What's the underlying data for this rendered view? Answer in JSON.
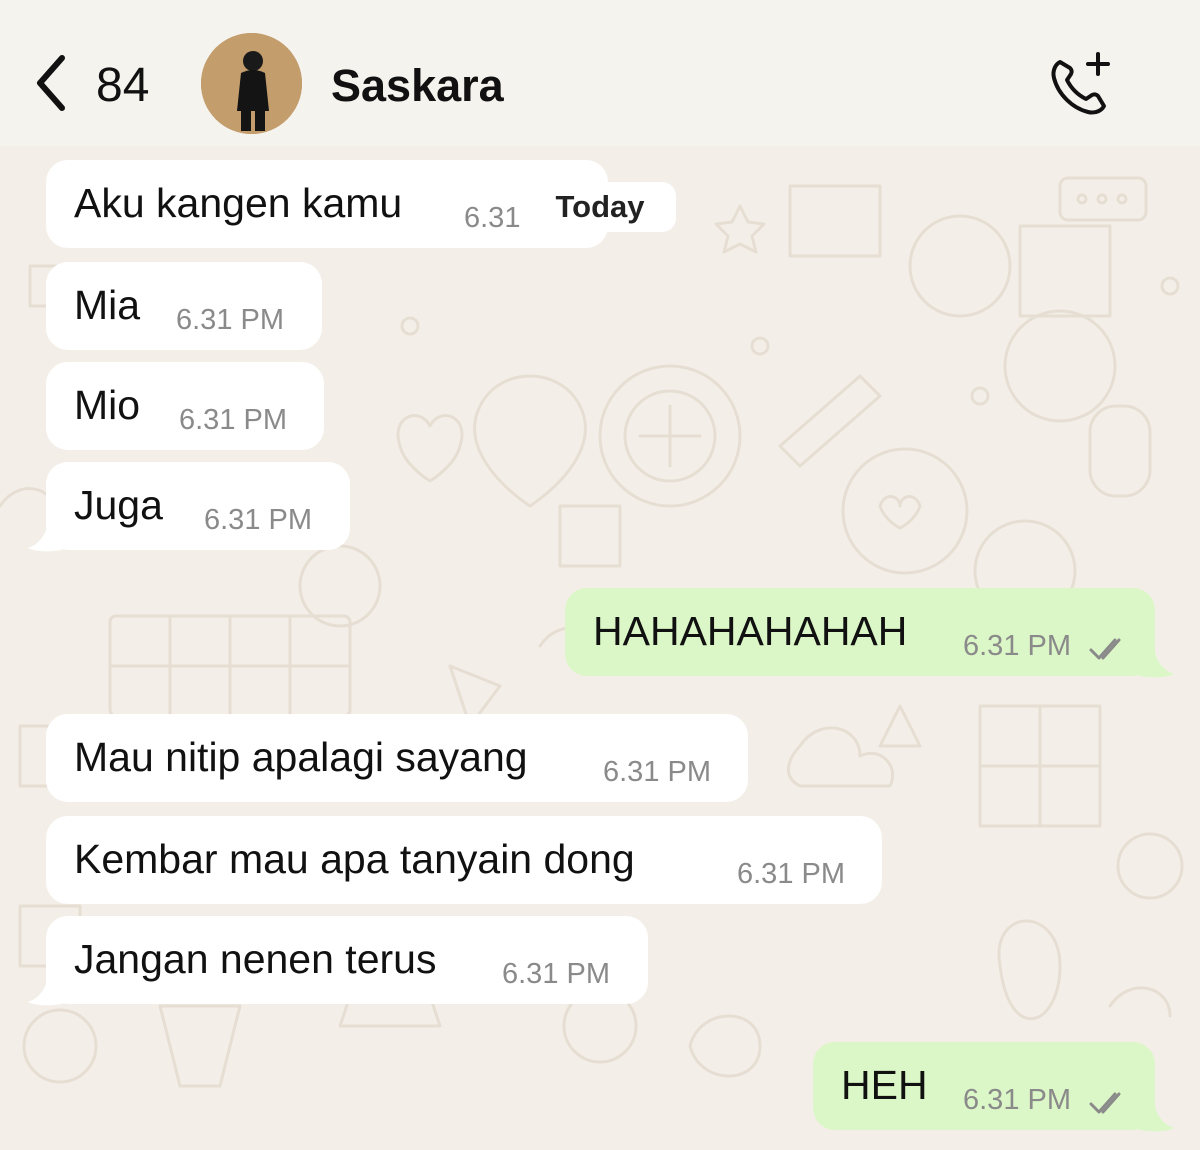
{
  "header": {
    "back_count": "84",
    "contact_name": "Saskara"
  },
  "date_divider": "Today",
  "messages": [
    {
      "text": "Aku kangen kamu",
      "time": "6.31 PM",
      "direction": "incoming"
    },
    {
      "text": "Mia",
      "time": "6.31 PM",
      "direction": "incoming"
    },
    {
      "text": "Mio",
      "time": "6.31 PM",
      "direction": "incoming"
    },
    {
      "text": "Juga",
      "time": "6.31 PM",
      "direction": "incoming"
    },
    {
      "text": "HAHAHAHAHAH",
      "time": "6.31 PM",
      "direction": "outgoing",
      "status": "read"
    },
    {
      "text": "Mau nitip apalagi sayang",
      "time": "6.31 PM",
      "direction": "incoming"
    },
    {
      "text": "Kembar mau apa tanyain dong",
      "time": "6.31 PM",
      "direction": "incoming"
    },
    {
      "text": "Jangan nenen terus",
      "time": "6.31 PM",
      "direction": "incoming"
    },
    {
      "text": "HEH",
      "time": "6.31 PM",
      "direction": "outgoing",
      "status": "read"
    }
  ],
  "icons": {
    "back": "chevron-left-icon",
    "call": "phone-add-icon",
    "read_receipt": "double-check-icon"
  },
  "colors": {
    "incoming_bubble": "#ffffff",
    "outgoing_bubble": "#dcf7c7",
    "wallpaper": "#f3efe8",
    "timestamp": "#8a8a8a"
  }
}
